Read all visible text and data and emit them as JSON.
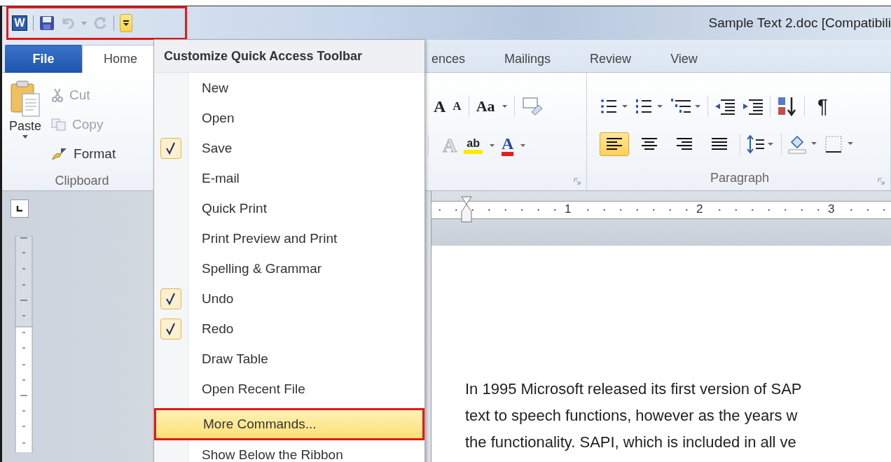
{
  "quick_access": {
    "app_letter": "W",
    "annotated": true,
    "undo_disabled": true,
    "redo_disabled": true,
    "customize_open": true
  },
  "window": {
    "title": "Sample Text 2.doc [Compatibili"
  },
  "tabs": [
    {
      "label": "File",
      "kind": "file",
      "selected": false
    },
    {
      "label": "Home",
      "kind": "tab",
      "selected": true
    },
    {
      "label": "ences",
      "kind": "tab",
      "selected": false
    },
    {
      "label": "Mailings",
      "kind": "tab",
      "selected": false
    },
    {
      "label": "Review",
      "kind": "tab",
      "selected": false
    },
    {
      "label": "View",
      "kind": "tab",
      "selected": false
    }
  ],
  "clipboard": {
    "paste_label": "Paste",
    "group_label": "Clipboard",
    "commands": [
      {
        "label": "Cut",
        "kind": "cut",
        "disabled": true
      },
      {
        "label": "Copy",
        "kind": "copy",
        "disabled": true
      },
      {
        "label": "Format",
        "kind": "format",
        "disabled": false
      }
    ]
  },
  "font": {
    "grow_glyph": "A",
    "shrink_glyph": "A",
    "case_glyph": "Aa",
    "effects_glyph": "A",
    "highlight_glyph": "ab",
    "color_glyph": "A"
  },
  "paragraph": {
    "group_label": "Paragraph",
    "pilcrow": "¶",
    "alignment": [
      {
        "kind": "left",
        "selected": true
      },
      {
        "kind": "center",
        "selected": false
      },
      {
        "kind": "right",
        "selected": false
      },
      {
        "kind": "justify",
        "selected": false
      }
    ]
  },
  "horizontal_ruler": {
    "labels": [
      "1",
      "2",
      "3"
    ]
  },
  "document": {
    "lines": [
      "In 1995 Microsoft released its first version of SAP",
      "text to speech functions, however as the years w",
      "the functionality.  SAPI, which is included in all ve"
    ]
  },
  "menu": {
    "title": "Customize Quick Access Toolbar",
    "items": [
      {
        "label": "New",
        "checked": false
      },
      {
        "label": "Open",
        "checked": false
      },
      {
        "label": "Save",
        "checked": true
      },
      {
        "label": "E-mail",
        "checked": false
      },
      {
        "label": "Quick Print",
        "checked": false
      },
      {
        "label": "Print Preview and Print",
        "checked": false
      },
      {
        "label": "Spelling & Grammar",
        "checked": false
      },
      {
        "label": "Undo",
        "checked": true
      },
      {
        "label": "Redo",
        "checked": true
      },
      {
        "label": "Draw Table",
        "checked": false
      },
      {
        "label": "Open Recent File",
        "checked": false
      }
    ],
    "footer_items": [
      {
        "label": "More Commands...",
        "selected": true,
        "annotated": true
      },
      {
        "label": "Show Below the Ribbon",
        "selected": false,
        "annotated": false
      }
    ]
  }
}
